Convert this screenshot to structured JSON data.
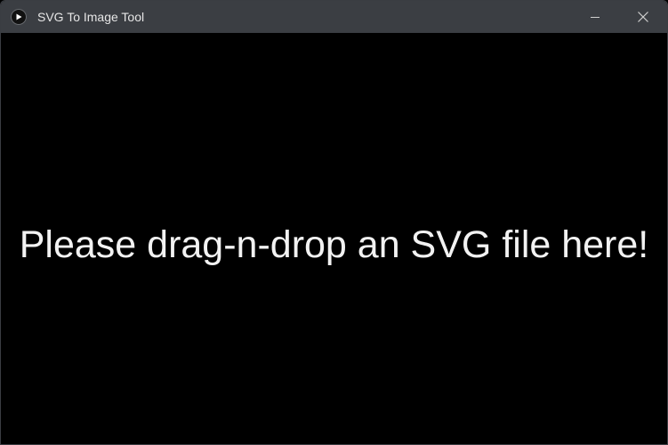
{
  "window": {
    "title": "SVG To Image Tool"
  },
  "titlebar_buttons": {
    "minimize_icon": "minimize-icon",
    "close_icon": "close-icon"
  },
  "drop_zone": {
    "message": "Please drag-n-drop an SVG file here!"
  },
  "colors": {
    "titlebar_bg": "#3b3e43",
    "content_bg": "#000000",
    "text": "#f2f2f2"
  }
}
